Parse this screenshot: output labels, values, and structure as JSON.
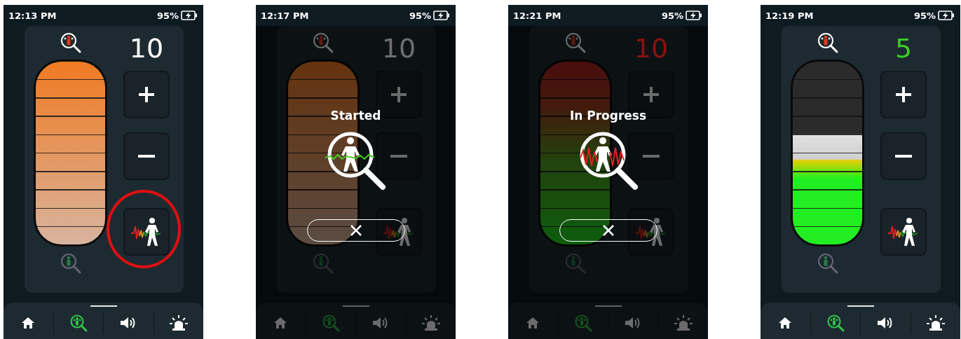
{
  "screens": [
    {
      "time": "12:13 PM",
      "battery": "95%",
      "count": {
        "value": "10",
        "color": "#ffffff"
      },
      "meter": {
        "kind": "orange",
        "level": 1
      },
      "scan_button": {
        "highlighted": true
      },
      "nav": [
        {
          "selected": false
        },
        {
          "selected": true
        },
        {
          "selected": false
        },
        {
          "selected": false
        }
      ]
    },
    {
      "time": "12:17 PM",
      "battery": "95%",
      "count": {
        "value": "10",
        "color": "#6e6e6e"
      },
      "meter": {
        "kind": "orange",
        "level": 1
      },
      "scan_button": {
        "highlighted": false
      },
      "overlay": {
        "title": "Started",
        "kind": "started"
      },
      "nav": [
        {
          "selected": false
        },
        {
          "selected": true
        },
        {
          "selected": false
        },
        {
          "selected": false
        }
      ]
    },
    {
      "time": "12:21 PM",
      "battery": "95%",
      "count": {
        "value": "10",
        "color": "#8c1010"
      },
      "meter": {
        "kind": "red-green",
        "level": 1
      },
      "scan_button": {
        "highlighted": false
      },
      "overlay": {
        "title": "In Progress",
        "kind": "in-progress"
      },
      "nav": [
        {
          "selected": false
        },
        {
          "selected": true
        },
        {
          "selected": false
        },
        {
          "selected": false
        }
      ]
    },
    {
      "time": "12:19 PM",
      "battery": "95%",
      "count": {
        "value": "5",
        "color": "#3ccc28"
      },
      "meter": {
        "kind": "green",
        "level": 0.6
      },
      "scan_button": {
        "highlighted": false
      },
      "nav": [
        {
          "selected": false
        },
        {
          "selected": true
        },
        {
          "selected": false
        },
        {
          "selected": false
        }
      ]
    }
  ]
}
